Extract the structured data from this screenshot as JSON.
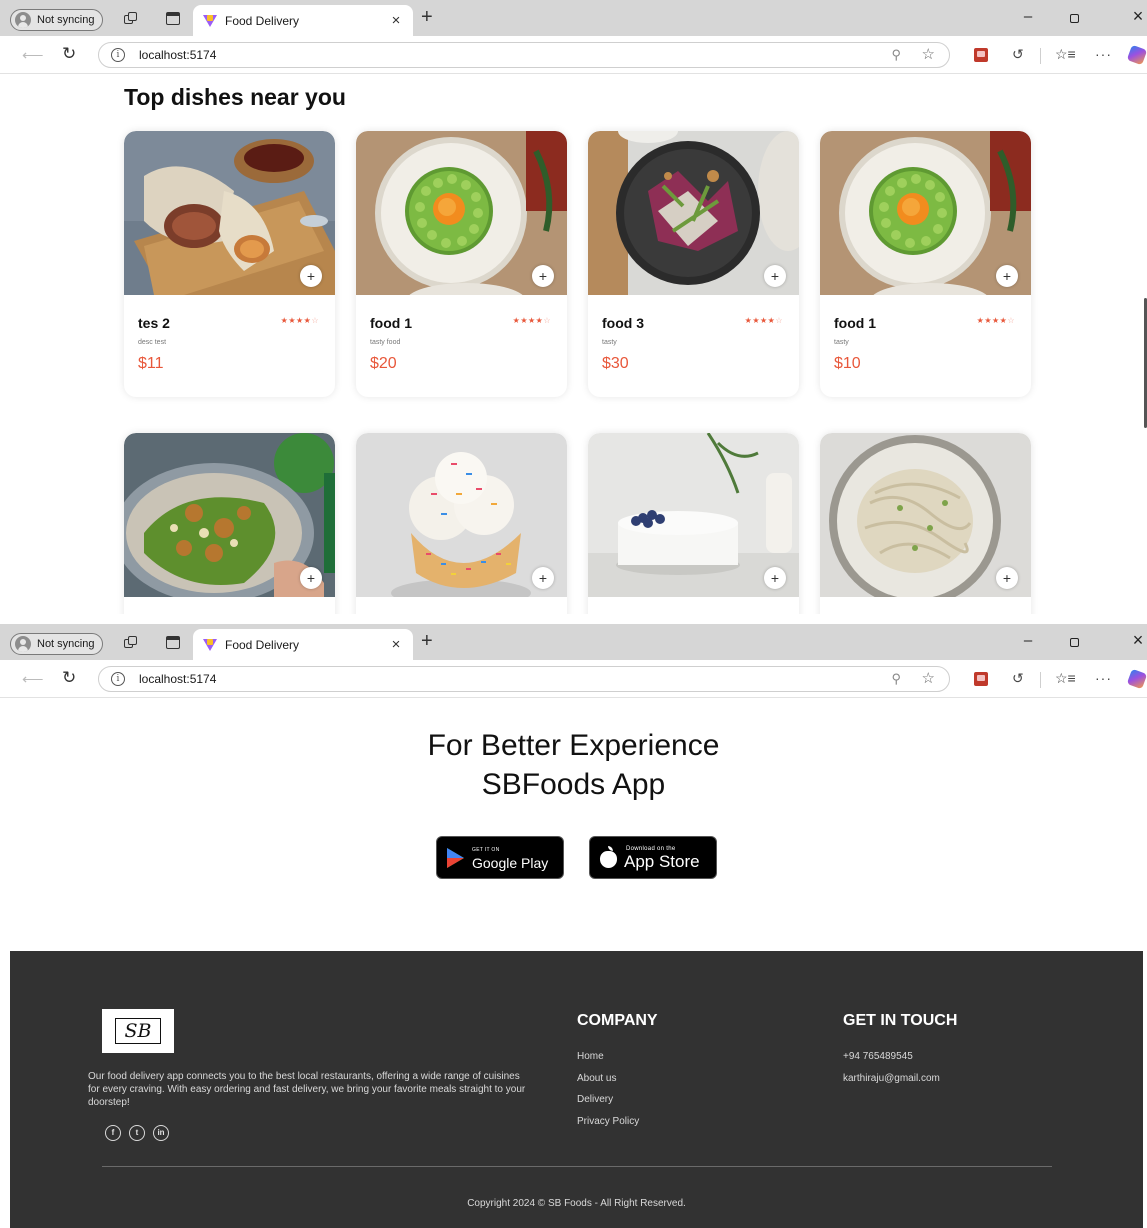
{
  "browser": {
    "profile_label": "Not syncing",
    "tab_title": "Food Delivery",
    "tab_close": "×",
    "new_tab": "+",
    "url": "localhost:5174",
    "window_controls": {
      "minimize": "–",
      "restore": "▫",
      "close": "×"
    },
    "icons": [
      "back-arrow-icon",
      "reload-icon",
      "info-icon",
      "zoom-icon",
      "favorite-star-icon",
      "extension-icon",
      "sync-icon",
      "favorites-icon",
      "more-icon",
      "copilot-icon"
    ]
  },
  "menu_section": {
    "title": "Top dishes near you",
    "food_items": [
      {
        "name": "tes 2",
        "desc": "desc test",
        "price": "$11",
        "rating": 4,
        "image": "burrito"
      },
      {
        "name": "food 1",
        "desc": "tasty food",
        "price": "$20",
        "rating": 4,
        "image": "peas-egg-plate"
      },
      {
        "name": "food 3",
        "desc": "tasty",
        "price": "$30",
        "rating": 4,
        "image": "salad-dark-plate"
      },
      {
        "name": "food 1",
        "desc": "tasty",
        "price": "$10",
        "rating": 4,
        "image": "peas-egg-plate"
      },
      {
        "name": "",
        "desc": "",
        "price": "",
        "rating": 0,
        "image": "caesar-salad"
      },
      {
        "name": "",
        "desc": "",
        "price": "",
        "rating": 0,
        "image": "sprinkle-ice-cream"
      },
      {
        "name": "",
        "desc": "",
        "price": "",
        "rating": 0,
        "image": "white-cake"
      },
      {
        "name": "",
        "desc": "",
        "price": "",
        "rating": 0,
        "image": "pasta-bowl"
      }
    ],
    "add_glyph": "+"
  },
  "app_download": {
    "line1": "For Better Experience",
    "line2": "SBFoods App",
    "google_play": {
      "small": "GET IT ON",
      "big": "Google Play"
    },
    "app_store": {
      "small": "Download on the",
      "big": "App Store"
    }
  },
  "footer": {
    "logo_text": "SB",
    "description": "Our food delivery app connects you to the best local restaurants, offering a wide range of cuisines for every craving. With easy ordering and fast delivery, we bring your favorite meals straight to your doorstep!",
    "socials": [
      "f",
      "t",
      "in"
    ],
    "company_heading": "COMPANY",
    "company_links": [
      "Home",
      "About us",
      "Delivery",
      "Privacy Policy"
    ],
    "contact_heading": "GET IN TOUCH",
    "contact": [
      "+94 765489545",
      "karthiraju@gmail.com"
    ],
    "copyright": "Copyright 2024 © SB Foods - All Right Reserved."
  },
  "colors": {
    "accent": "#e8573a",
    "footer_bg": "#323232",
    "tabstrip_bg": "#d6d6d6"
  }
}
